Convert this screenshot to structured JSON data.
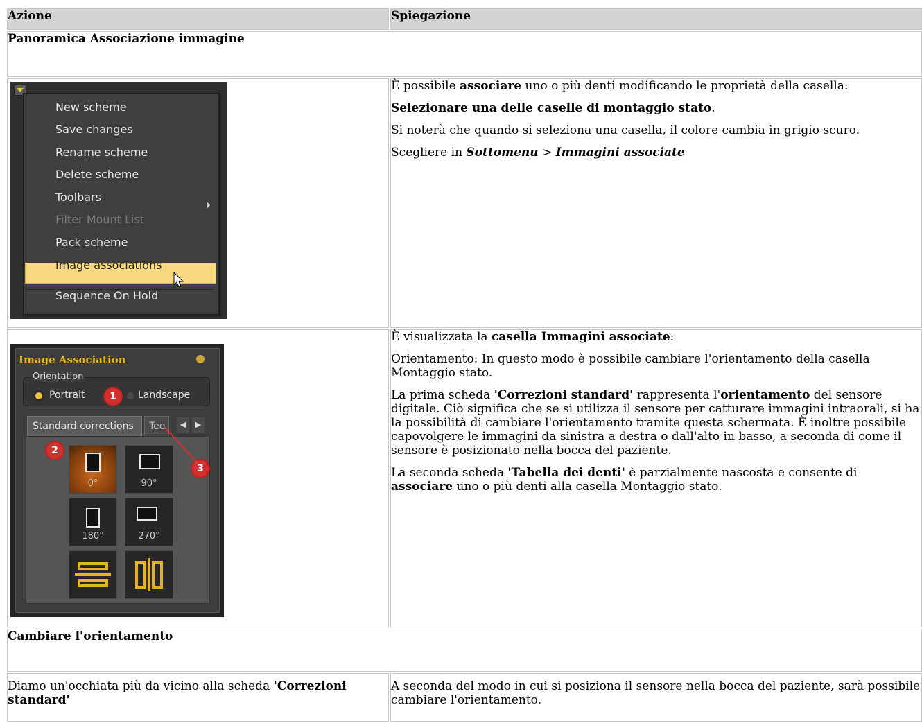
{
  "header": {
    "col1": "Azione",
    "col2": "Spiegazione"
  },
  "section1": {
    "title": "Panoramica Associazione immagine"
  },
  "menu": {
    "items": [
      {
        "label": "New scheme",
        "disabled": false
      },
      {
        "label": "Save changes",
        "disabled": false
      },
      {
        "label": "Rename scheme",
        "disabled": false
      },
      {
        "label": "Delete scheme",
        "disabled": false
      },
      {
        "label": "Toolbars",
        "disabled": false,
        "submenu": true
      },
      {
        "label": "Filter Mount List",
        "disabled": true
      },
      {
        "label": "Pack scheme",
        "disabled": false
      },
      {
        "label": "Image associations",
        "disabled": false,
        "selected": true
      },
      {
        "label": "Sequence On Hold",
        "disabled": false
      }
    ]
  },
  "row1": {
    "p1_a": "È possibile ",
    "p1_b": "associare",
    "p1_c": " uno o più denti modificando le proprietà della casella:",
    "p2_a": "Selezionare una delle caselle di montaggio stato",
    "p2_b": ".",
    "p3": "Si noterà che quando si seleziona una casella, il colore cambia in grigio scuro.",
    "p4_a": "Scegliere in ",
    "p4_b": "Sottomenu",
    "p4_c": " > ",
    "p4_d": "Immagini associate"
  },
  "ia": {
    "title": "Image Association",
    "orientation_label": "Orientation",
    "portrait": "Portrait",
    "landscape": "Landscape",
    "tab1": "Standard corrections",
    "tab2": "Tee",
    "tiles": [
      "0°",
      "90°",
      "180°",
      "270°"
    ],
    "badges": [
      "1",
      "2",
      "3"
    ],
    "accent": "#e6b422"
  },
  "row2": {
    "p1_a": "È visualizzata la ",
    "p1_b": "casella Immagini associate",
    "p1_c": ":",
    "p2": " Orientamento: In questo modo è possibile cambiare l'orientamento della casella Montaggio stato.",
    "p3_a": " La prima scheda ",
    "p3_b": "'Correzioni standard'",
    "p3_c": " rappresenta l'",
    "p3_d": "orientamento",
    "p3_e": " del sensore digitale.  Ciò significa che se si utilizza il sensore per catturare immagini intraorali, si ha la possibilità di cambiare l'orientamento tramite questa schermata. È inoltre possibile capovolgere le immagini da sinistra a destra o dall'alto in basso, a seconda di come il sensore è posizionato nella bocca del paziente.",
    "p4_a": " La seconda scheda ",
    "p4_b": "'Tabella dei denti'",
    "p4_c": " è parzialmente nascosta e consente di ",
    "p4_d": "associare",
    "p4_e": " uno o più denti alla casella Montaggio stato."
  },
  "section2": {
    "title": "Cambiare l'orientamento"
  },
  "row3": {
    "left_a": "Diamo un'occhiata più da vicino alla scheda ",
    "left_b": "'Correzioni standard'",
    "right": "A seconda del modo in cui si posiziona il sensore nella bocca del paziente, sarà possibile cambiare l'orientamento."
  }
}
